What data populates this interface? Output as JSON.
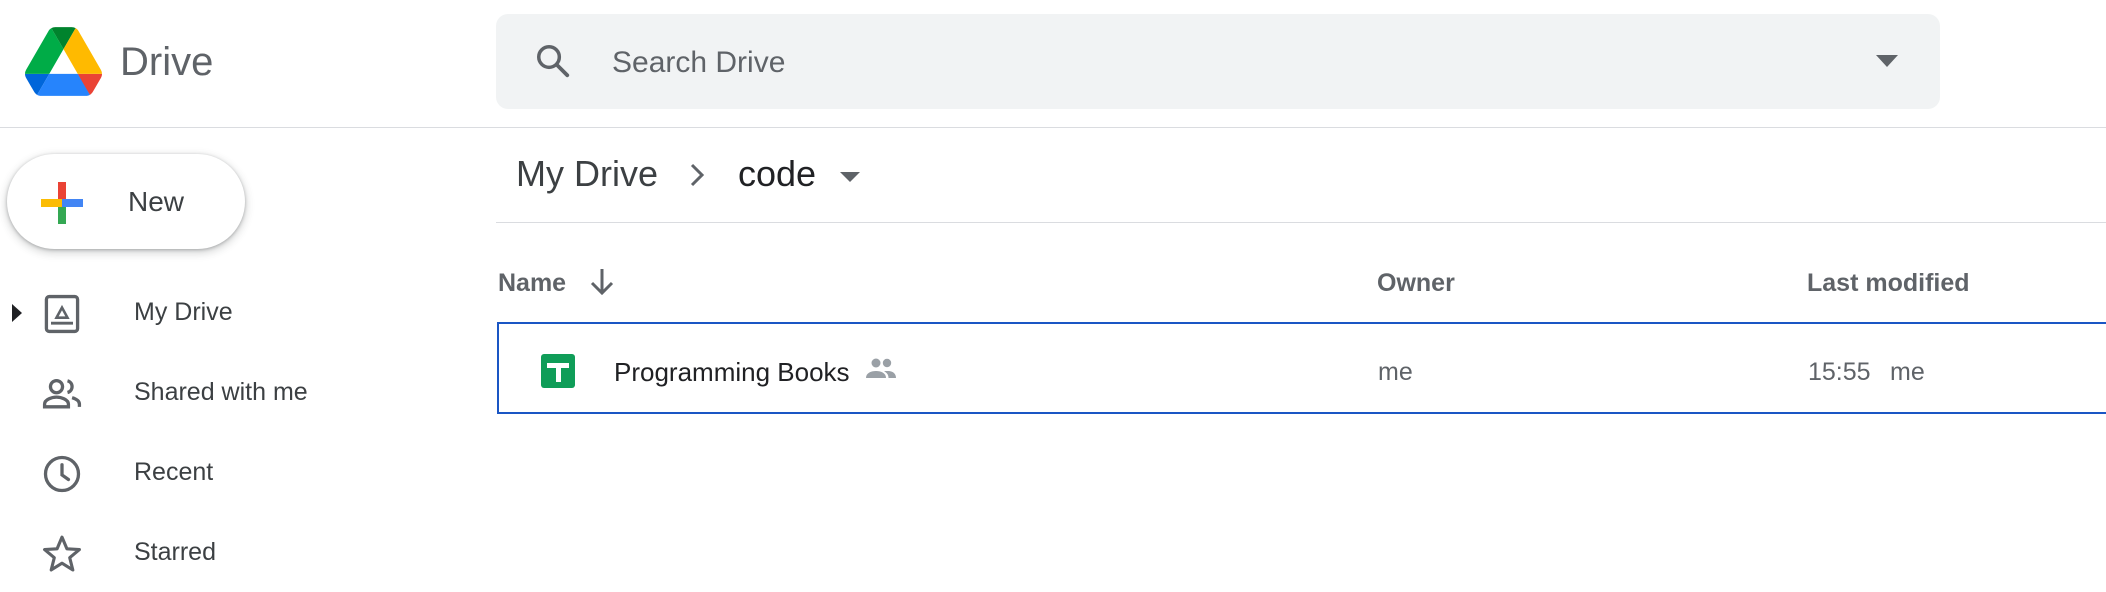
{
  "header": {
    "app_name": "Drive",
    "search": {
      "placeholder": "Search Drive",
      "value": ""
    }
  },
  "sidebar": {
    "new_label": "New",
    "items": [
      {
        "label": "My Drive",
        "icon": "my-drive-icon"
      },
      {
        "label": "Shared with me",
        "icon": "people-icon"
      },
      {
        "label": "Recent",
        "icon": "clock-icon"
      },
      {
        "label": "Starred",
        "icon": "star-icon"
      }
    ]
  },
  "breadcrumb": {
    "root": "My Drive",
    "current": "code"
  },
  "list": {
    "columns": {
      "name": "Name",
      "owner": "Owner",
      "modified": "Last modified"
    },
    "rows": [
      {
        "name": "Programming Books",
        "owner": "me",
        "modified": "15:55",
        "modified_by": "me",
        "icon": "sheets-icon",
        "shared": true
      }
    ]
  },
  "colors": {
    "accent": "#1a56c4",
    "sheets_green": "#0f9d58",
    "text_primary": "#202124",
    "text_secondary": "#5f6368"
  }
}
